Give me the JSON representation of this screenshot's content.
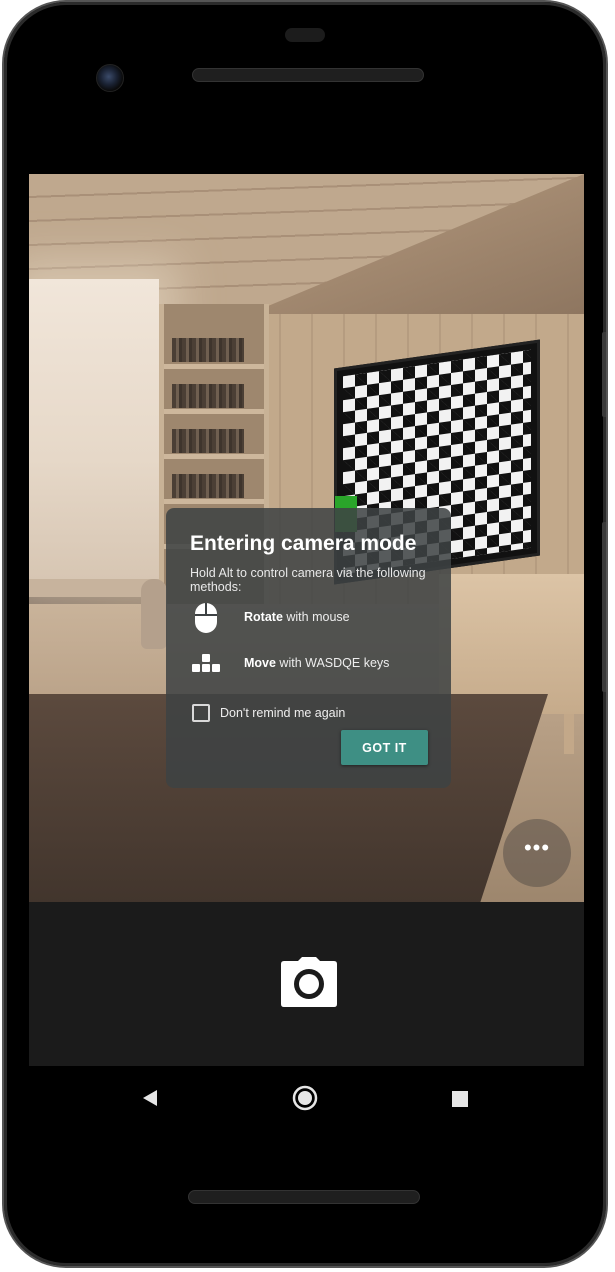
{
  "dialog": {
    "title": "Entering camera mode",
    "subtitle": "Hold Alt to control camera via the following methods:",
    "methods": [
      {
        "icon": "mouse-icon",
        "action": "Rotate",
        "detail": " with mouse"
      },
      {
        "icon": "keys-icon",
        "action": "Move",
        "detail": " with WASDQE keys"
      }
    ],
    "remind_label": "Don't remind me again",
    "remind_checked": false,
    "confirm_label": "GOT IT"
  },
  "overlay": {
    "more_label": "•••"
  },
  "bottom_bar": {
    "capture_icon": "camera-icon"
  },
  "navigation": {
    "back_icon": "back-triangle-icon",
    "home_icon": "home-circle-icon",
    "recents_icon": "recents-square-icon"
  },
  "colors": {
    "accent": "#3e8f84",
    "dialog_bg": "#3e4244",
    "bottom_panel": "#1b1b1b"
  }
}
